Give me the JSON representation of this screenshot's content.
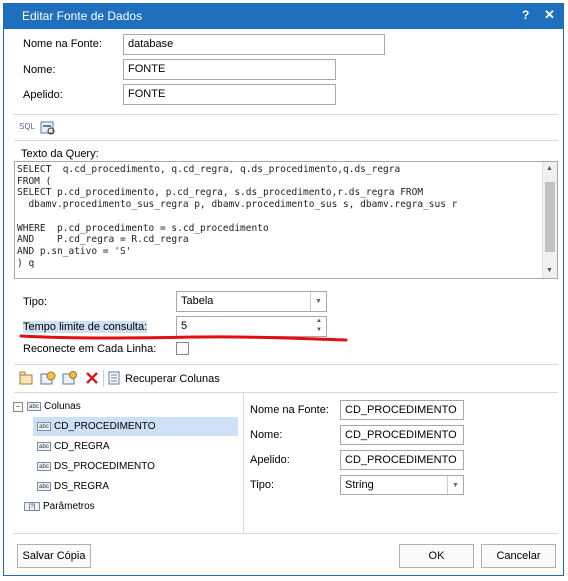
{
  "dialog": {
    "title": "Editar Fonte de Dados",
    "help": "?",
    "close": "✕"
  },
  "fields": {
    "nome_fonte_label": "Nome na Fonte:",
    "nome_fonte_value": "database",
    "nome_label": "Nome:",
    "nome_value": "FONTE",
    "apelido_label": "Apelido:",
    "apelido_value": "FONTE"
  },
  "toolbar1": {
    "sql_icon": "SQL"
  },
  "query": {
    "label": "Texto da Query:",
    "text": "SELECT  q.cd_procedimento, q.cd_regra, q.ds_procedimento,q.ds_regra\nFROM (\nSELECT p.cd_procedimento, p.cd_regra, s.ds_procedimento,r.ds_regra FROM\n  dbamv.procedimento_sus_regra p, dbamv.procedimento_sus s, dbamv.regra_sus r\n\nWHERE  p.cd_procedimento = s.cd_procedimento\nAND    P.cd_regra = R.cd_regra\nAND p.sn_ativo = 'S'\n) q"
  },
  "options": {
    "tipo_label": "Tipo:",
    "tipo_value": "Tabela",
    "tempo_label": "Tempo limite de consulta:",
    "tempo_value": "5",
    "reconecte_label": "Reconecte em Cada Linha:"
  },
  "toolbar2": {
    "recuperar": "Recuperar Colunas"
  },
  "tree": {
    "root": "Colunas",
    "columns": [
      "CD_PROCEDIMENTO",
      "CD_REGRA",
      "DS_PROCEDIMENTO",
      "DS_REGRA"
    ],
    "params": "Parâmetros",
    "col_icon": "abc",
    "param_icon": "[?]"
  },
  "details": {
    "nome_fonte_label": "Nome na Fonte:",
    "nome_fonte_value": "CD_PROCEDIMENTO",
    "nome_label": "Nome:",
    "nome_value": "CD_PROCEDIMENTO",
    "apelido_label": "Apelido:",
    "apelido_value": "CD_PROCEDIMENTO",
    "tipo_label": "Tipo:",
    "tipo_value": "String"
  },
  "footer": {
    "salvar": "Salvar Cópia",
    "ok": "OK",
    "cancelar": "Cancelar"
  },
  "colors": {
    "titlebar": "#1f6fbf",
    "annotation": "#e01010",
    "selection": "#cde0f5"
  }
}
